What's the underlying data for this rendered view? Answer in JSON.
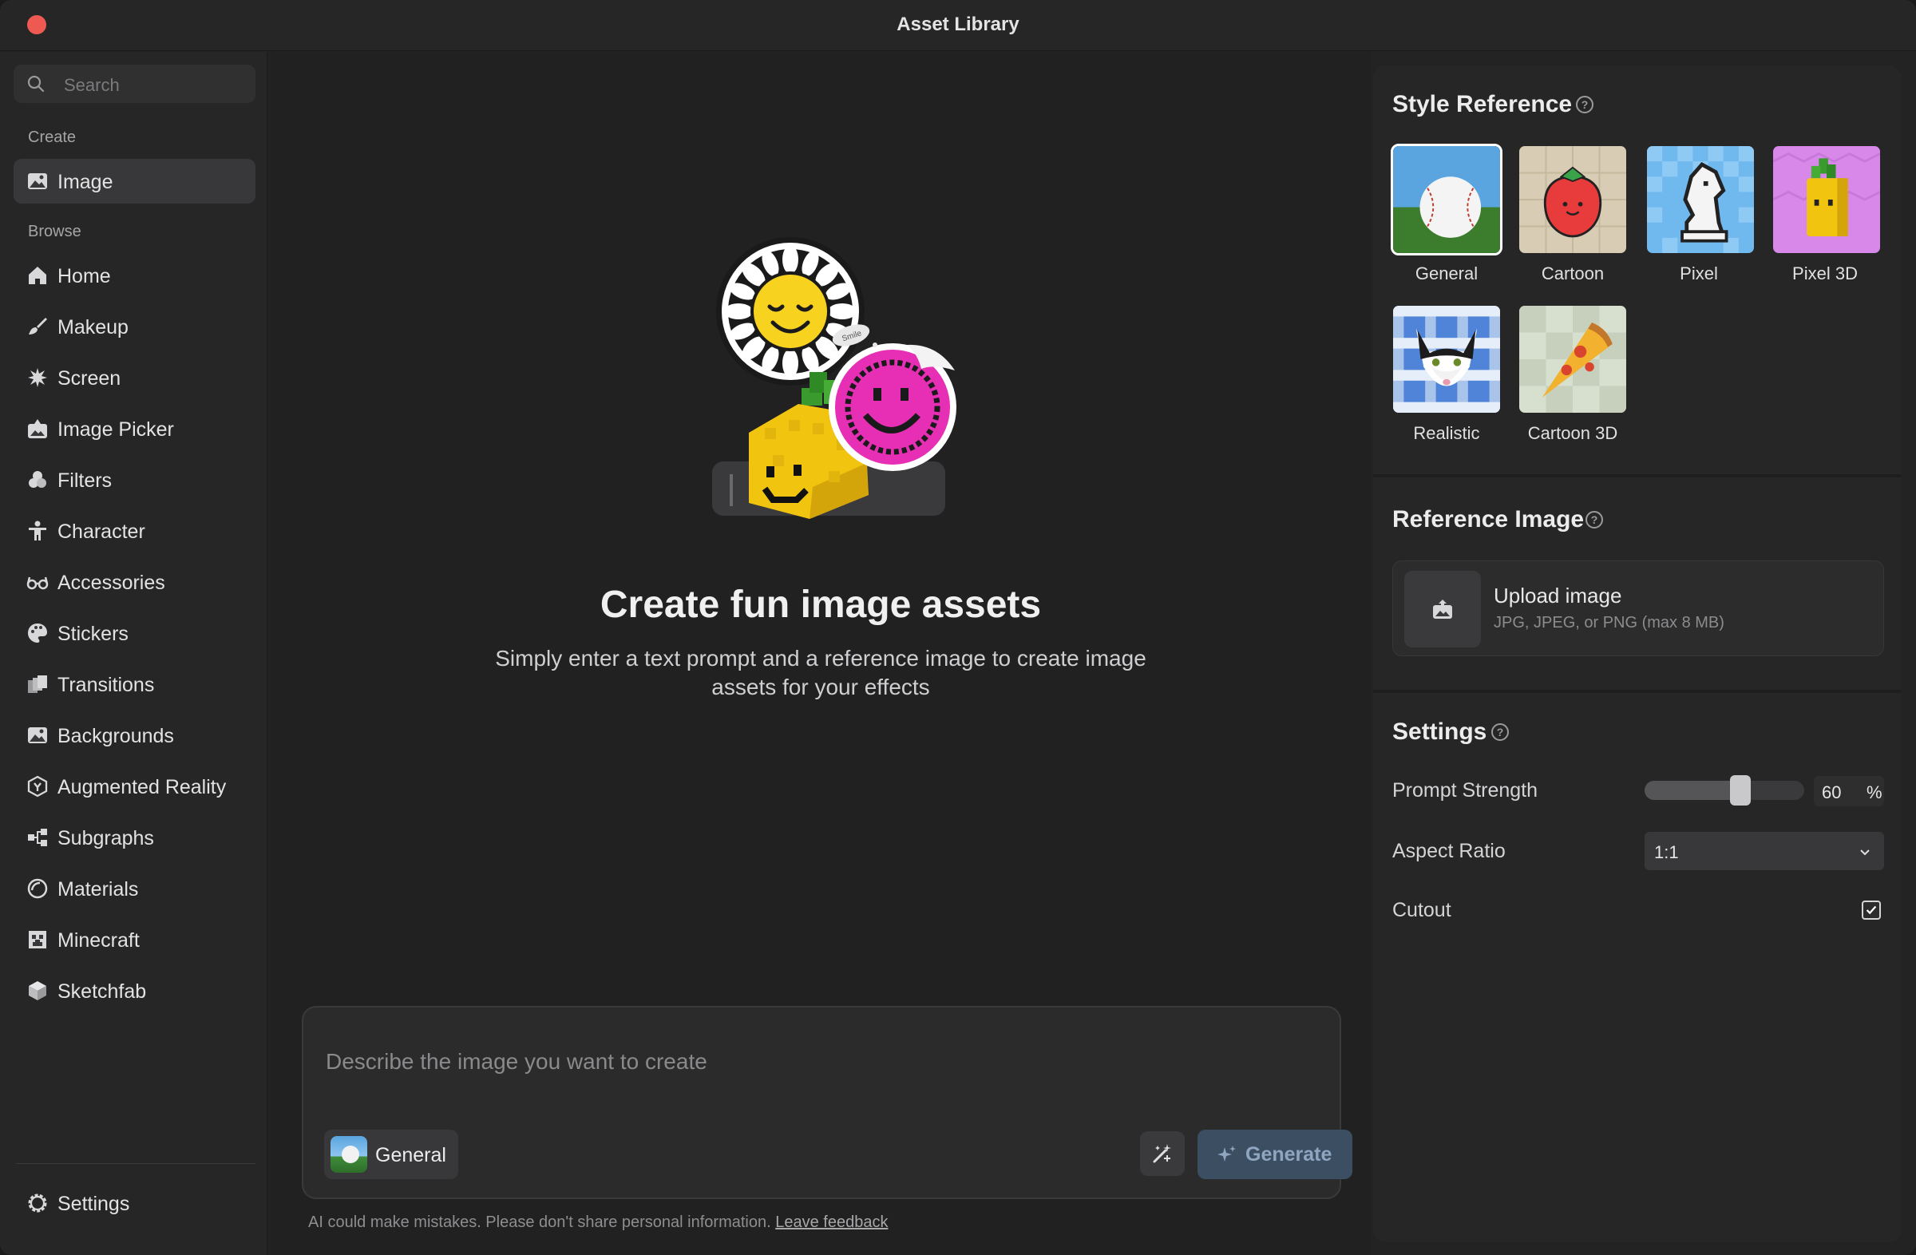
{
  "window": {
    "title": "Asset Library"
  },
  "sidebar": {
    "search_placeholder": "Search",
    "create_label": "Create",
    "browse_label": "Browse",
    "create_items": [
      {
        "label": "Image",
        "icon": "image-icon",
        "active": true
      }
    ],
    "browse_items": [
      {
        "label": "Home",
        "icon": "home-icon"
      },
      {
        "label": "Makeup",
        "icon": "brush-icon"
      },
      {
        "label": "Screen",
        "icon": "splat-icon"
      },
      {
        "label": "Image Picker",
        "icon": "image-picker-icon"
      },
      {
        "label": "Filters",
        "icon": "filters-icon"
      },
      {
        "label": "Character",
        "icon": "person-icon"
      },
      {
        "label": "Accessories",
        "icon": "glasses-icon"
      },
      {
        "label": "Stickers",
        "icon": "palette-icon"
      },
      {
        "label": "Transitions",
        "icon": "transitions-icon"
      },
      {
        "label": "Backgrounds",
        "icon": "backgrounds-icon"
      },
      {
        "label": "Augmented Reality",
        "icon": "ar-icon"
      },
      {
        "label": "Subgraphs",
        "icon": "subgraphs-icon"
      },
      {
        "label": "Materials",
        "icon": "materials-icon"
      },
      {
        "label": "Minecraft",
        "icon": "minecraft-icon"
      },
      {
        "label": "Sketchfab",
        "icon": "cube-icon"
      }
    ],
    "settings_label": "Settings"
  },
  "main": {
    "hero_title": "Create fun image assets",
    "hero_subtitle": "Simply enter a text prompt and a reference image to create image assets for your effects",
    "prompt_placeholder": "Describe the image you want to create",
    "style_chip_label": "General",
    "generate_label": "Generate",
    "disclaimer": "AI could make mistakes. Please don't share personal information.",
    "feedback_link": "Leave feedback",
    "hero_sticker_text": "Smile"
  },
  "panel": {
    "style_reference_title": "Style Reference",
    "styles": [
      {
        "label": "General",
        "selected": true
      },
      {
        "label": "Cartoon",
        "selected": false
      },
      {
        "label": "Pixel",
        "selected": false
      },
      {
        "label": "Pixel 3D",
        "selected": false
      },
      {
        "label": "Realistic",
        "selected": false
      },
      {
        "label": "Cartoon 3D",
        "selected": false
      }
    ],
    "reference_image_title": "Reference Image",
    "upload_title": "Upload image",
    "upload_hint": "JPG, JPEG, or PNG (max 8 MB)",
    "settings_title": "Settings",
    "prompt_strength_label": "Prompt Strength",
    "prompt_strength_value": 60,
    "prompt_strength_unit": "%",
    "aspect_ratio_label": "Aspect Ratio",
    "aspect_ratio_value": "1:1",
    "cutout_label": "Cutout",
    "cutout_checked": true
  },
  "colors": {
    "close_button": "#ee5a52",
    "generate_bg": "#3c4e62",
    "accent_selected": "#ffffff"
  }
}
